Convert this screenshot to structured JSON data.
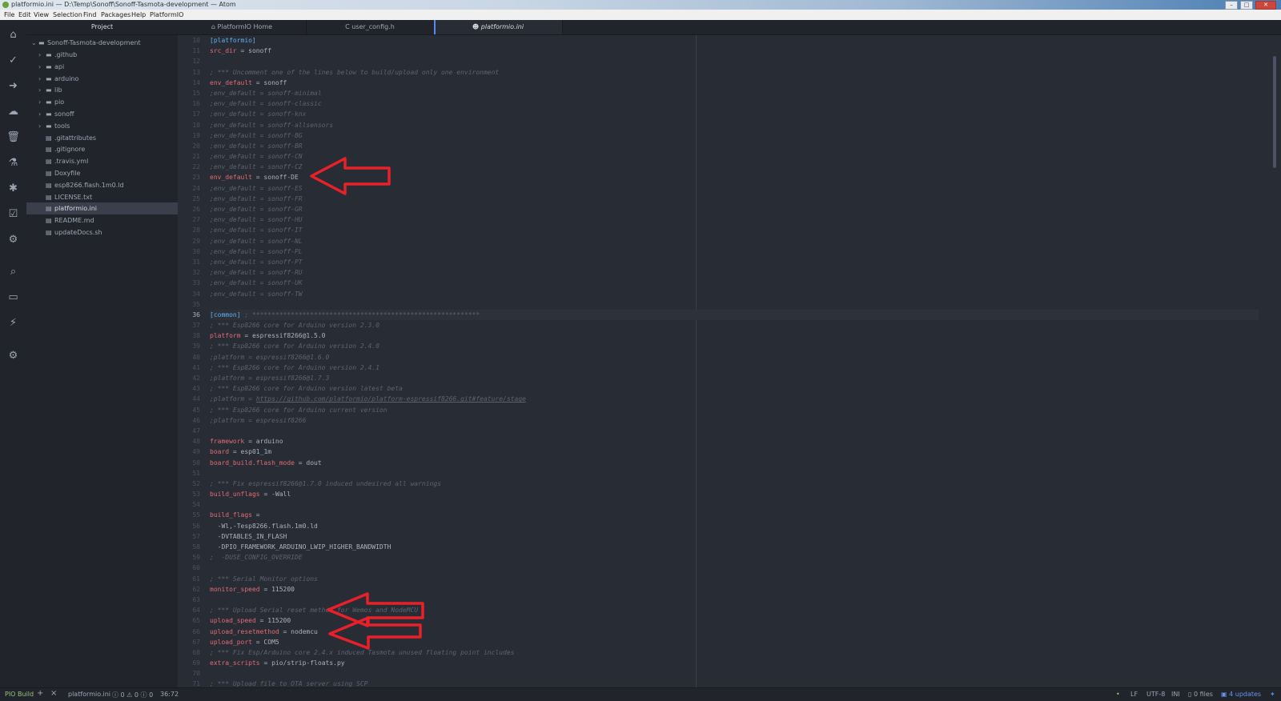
{
  "window": {
    "title": "platformio.ini — D:\\Temp\\Sonoff\\Sonoff-Tasmota-development — Atom"
  },
  "menu": [
    "File",
    "Edit",
    "View",
    "Selection",
    "Find",
    "Packages",
    "Help",
    "PlatformIO"
  ],
  "left_toolbar": [
    "home-icon",
    "check-icon",
    "arrow-right-icon",
    "cloud-upload-icon",
    "trash-icon",
    "flask-icon",
    "bug-icon",
    "task-list-icon",
    "network-icon",
    "search-icon",
    "terminal-icon",
    "plug-icon",
    "gear-icon"
  ],
  "tree": {
    "header": "Project",
    "root": "Sonoff-Tasmota-development",
    "items": [
      {
        "label": ".github",
        "type": "folder"
      },
      {
        "label": "api",
        "type": "folder"
      },
      {
        "label": "arduino",
        "type": "folder"
      },
      {
        "label": "lib",
        "type": "folder"
      },
      {
        "label": "pio",
        "type": "folder"
      },
      {
        "label": "sonoff",
        "type": "folder"
      },
      {
        "label": "tools",
        "type": "folder"
      },
      {
        "label": ".gitattributes",
        "type": "file"
      },
      {
        "label": ".gitignore",
        "type": "file"
      },
      {
        "label": ".travis.yml",
        "type": "file"
      },
      {
        "label": "Doxyfile",
        "type": "file"
      },
      {
        "label": "esp8266.flash.1m0.ld",
        "type": "file"
      },
      {
        "label": "LICENSE.txt",
        "type": "file"
      },
      {
        "label": "platformio.ini",
        "type": "file",
        "selected": true
      },
      {
        "label": "README.md",
        "type": "file"
      },
      {
        "label": "updateDocs.sh",
        "type": "file"
      }
    ]
  },
  "tabs": [
    {
      "label": "PlatformIO Home"
    },
    {
      "label": "user_config.h"
    },
    {
      "label": "platformio.ini",
      "active": true
    }
  ],
  "editor": {
    "lines": [
      {
        "n": "10",
        "parts": [
          {
            "c": "sec",
            "t": "[platformio]"
          }
        ]
      },
      {
        "n": "11",
        "parts": [
          {
            "c": "key",
            "t": "src_dir"
          },
          {
            "c": "val",
            "t": " = sonoff"
          }
        ]
      },
      {
        "n": "12",
        "parts": []
      },
      {
        "n": "13",
        "parts": [
          {
            "c": "com",
            "t": "; *** Uncomment one of the lines below to build/upload only one environment"
          }
        ]
      },
      {
        "n": "14",
        "parts": [
          {
            "c": "key",
            "t": "env_default"
          },
          {
            "c": "val",
            "t": " = sonoff"
          }
        ]
      },
      {
        "n": "15",
        "parts": [
          {
            "c": "com",
            "t": ";env_default = sonoff-minimal"
          }
        ]
      },
      {
        "n": "16",
        "parts": [
          {
            "c": "com",
            "t": ";env_default = sonoff-classic"
          }
        ]
      },
      {
        "n": "17",
        "parts": [
          {
            "c": "com",
            "t": ";env_default = sonoff-knx"
          }
        ]
      },
      {
        "n": "18",
        "parts": [
          {
            "c": "com",
            "t": ";env_default = sonoff-allsensors"
          }
        ]
      },
      {
        "n": "19",
        "parts": [
          {
            "c": "com",
            "t": ";env_default = sonoff-BG"
          }
        ]
      },
      {
        "n": "20",
        "parts": [
          {
            "c": "com",
            "t": ";env_default = sonoff-BR"
          }
        ]
      },
      {
        "n": "21",
        "parts": [
          {
            "c": "com",
            "t": ";env_default = sonoff-CN"
          }
        ]
      },
      {
        "n": "22",
        "parts": [
          {
            "c": "com",
            "t": ";env_default = sonoff-CZ"
          }
        ]
      },
      {
        "n": "23",
        "parts": [
          {
            "c": "key",
            "t": "env_default"
          },
          {
            "c": "val",
            "t": " = sonoff-DE"
          }
        ]
      },
      {
        "n": "24",
        "parts": [
          {
            "c": "com",
            "t": ";env_default = sonoff-ES"
          }
        ]
      },
      {
        "n": "25",
        "parts": [
          {
            "c": "com",
            "t": ";env_default = sonoff-FR"
          }
        ]
      },
      {
        "n": "26",
        "parts": [
          {
            "c": "com",
            "t": ";env_default = sonoff-GR"
          }
        ]
      },
      {
        "n": "27",
        "parts": [
          {
            "c": "com",
            "t": ";env_default = sonoff-HU"
          }
        ]
      },
      {
        "n": "28",
        "parts": [
          {
            "c": "com",
            "t": ";env_default = sonoff-IT"
          }
        ]
      },
      {
        "n": "29",
        "parts": [
          {
            "c": "com",
            "t": ";env_default = sonoff-NL"
          }
        ]
      },
      {
        "n": "30",
        "parts": [
          {
            "c": "com",
            "t": ";env_default = sonoff-PL"
          }
        ]
      },
      {
        "n": "31",
        "parts": [
          {
            "c": "com",
            "t": ";env_default = sonoff-PT"
          }
        ]
      },
      {
        "n": "32",
        "parts": [
          {
            "c": "com",
            "t": ";env_default = sonoff-RU"
          }
        ]
      },
      {
        "n": "33",
        "parts": [
          {
            "c": "com",
            "t": ";env_default = sonoff-UK"
          }
        ]
      },
      {
        "n": "34",
        "parts": [
          {
            "c": "com",
            "t": ";env_default = sonoff-TW"
          }
        ]
      },
      {
        "n": "35",
        "parts": []
      },
      {
        "n": "36",
        "cur": true,
        "parts": [
          {
            "c": "sec",
            "t": "[common]"
          },
          {
            "c": "com",
            "t": " ; ***********************************************************"
          }
        ]
      },
      {
        "n": "37",
        "parts": [
          {
            "c": "com",
            "t": "; *** Esp8266 core for Arduino version 2.3.0"
          }
        ]
      },
      {
        "n": "38",
        "parts": [
          {
            "c": "key",
            "t": "platform"
          },
          {
            "c": "val",
            "t": " = espressif8266@1.5.0"
          }
        ]
      },
      {
        "n": "39",
        "parts": [
          {
            "c": "com",
            "t": "; *** Esp8266 core for Arduino version 2.4.0"
          }
        ]
      },
      {
        "n": "40",
        "parts": [
          {
            "c": "com",
            "t": ";platform = espressif8266@1.6.0"
          }
        ]
      },
      {
        "n": "41",
        "parts": [
          {
            "c": "com",
            "t": "; *** Esp8266 core for Arduino version 2.4.1"
          }
        ]
      },
      {
        "n": "42",
        "parts": [
          {
            "c": "com",
            "t": ";platform = espressif8266@1.7.3"
          }
        ]
      },
      {
        "n": "43",
        "parts": [
          {
            "c": "com",
            "t": "; *** Esp8266 core for Arduino version latest beta"
          }
        ]
      },
      {
        "n": "44",
        "parts": [
          {
            "c": "com",
            "t": ";platform = "
          },
          {
            "c": "link",
            "t": "https://github.com/platformio/platform-espressif8266.git#feature/stage"
          }
        ]
      },
      {
        "n": "45",
        "parts": [
          {
            "c": "com",
            "t": "; *** Esp8266 core for Arduino current version"
          }
        ]
      },
      {
        "n": "46",
        "parts": [
          {
            "c": "com",
            "t": ";platform = espressif8266"
          }
        ]
      },
      {
        "n": "47",
        "parts": []
      },
      {
        "n": "48",
        "parts": [
          {
            "c": "key",
            "t": "framework"
          },
          {
            "c": "val",
            "t": " = arduino"
          }
        ]
      },
      {
        "n": "49",
        "parts": [
          {
            "c": "key",
            "t": "board"
          },
          {
            "c": "val",
            "t": " = esp01_1m"
          }
        ]
      },
      {
        "n": "50",
        "parts": [
          {
            "c": "key",
            "t": "board_build.flash_mode"
          },
          {
            "c": "val",
            "t": " = dout"
          }
        ]
      },
      {
        "n": "51",
        "parts": []
      },
      {
        "n": "52",
        "parts": [
          {
            "c": "com",
            "t": "; *** Fix espressif8266@1.7.0 induced undesired all warnings"
          }
        ]
      },
      {
        "n": "53",
        "parts": [
          {
            "c": "key",
            "t": "build_unflags"
          },
          {
            "c": "val",
            "t": " = -Wall"
          }
        ]
      },
      {
        "n": "54",
        "parts": []
      },
      {
        "n": "55",
        "parts": [
          {
            "c": "key",
            "t": "build_flags"
          },
          {
            "c": "val",
            "t": " ="
          }
        ]
      },
      {
        "n": "56",
        "parts": [
          {
            "c": "val",
            "t": "  -Wl,-Tesp8266.flash.1m0.ld"
          }
        ]
      },
      {
        "n": "57",
        "parts": [
          {
            "c": "val",
            "t": "  -DVTABLES_IN_FLASH"
          }
        ]
      },
      {
        "n": "58",
        "parts": [
          {
            "c": "val",
            "t": "  -DPIO_FRAMEWORK_ARDUINO_LWIP_HIGHER_BANDWIDTH"
          }
        ]
      },
      {
        "n": "59",
        "parts": [
          {
            "c": "com",
            "t": ";  -DUSE_CONFIG_OVERRIDE"
          }
        ]
      },
      {
        "n": "60",
        "parts": []
      },
      {
        "n": "61",
        "parts": [
          {
            "c": "com",
            "t": "; *** Serial Monitor options"
          }
        ]
      },
      {
        "n": "62",
        "parts": [
          {
            "c": "key",
            "t": "monitor_speed"
          },
          {
            "c": "val",
            "t": " = 115200"
          }
        ]
      },
      {
        "n": "63",
        "parts": []
      },
      {
        "n": "64",
        "parts": [
          {
            "c": "com",
            "t": "; *** Upload Serial reset method for Wemos and NodeMCU"
          }
        ]
      },
      {
        "n": "65",
        "parts": [
          {
            "c": "key",
            "t": "upload_speed"
          },
          {
            "c": "val",
            "t": " = 115200"
          }
        ]
      },
      {
        "n": "66",
        "parts": [
          {
            "c": "key",
            "t": "upload_resetmethod"
          },
          {
            "c": "val",
            "t": " = nodemcu"
          }
        ]
      },
      {
        "n": "67",
        "parts": [
          {
            "c": "key",
            "t": "upload_port"
          },
          {
            "c": "val",
            "t": " = COM5"
          }
        ]
      },
      {
        "n": "68",
        "parts": [
          {
            "c": "com",
            "t": "; *** Fix Esp/Arduino core 2.4.x induced Tasmota unused floating point includes"
          }
        ]
      },
      {
        "n": "69",
        "parts": [
          {
            "c": "key",
            "t": "extra_scripts"
          },
          {
            "c": "val",
            "t": " = pio/strip-floats.py"
          }
        ]
      },
      {
        "n": "70",
        "parts": []
      },
      {
        "n": "71",
        "parts": [
          {
            "c": "com",
            "t": "; *** Upload file to OTA server using SCP"
          }
        ]
      }
    ]
  },
  "status": {
    "build": "PIO Build",
    "add": "+",
    "close": "×",
    "file": "platformio.ini",
    "diagnostics": "ⓘ 0 ⚠ 0 ⓘ 0",
    "cursor": "36:72",
    "line_ending": "LF",
    "encoding": "UTF-8",
    "grammar": "INI",
    "files": "0 files",
    "updates": "4 updates"
  },
  "colors": {
    "annotation_arrow": "#e8202a",
    "accent": "#568af2",
    "background": "#282c34"
  }
}
